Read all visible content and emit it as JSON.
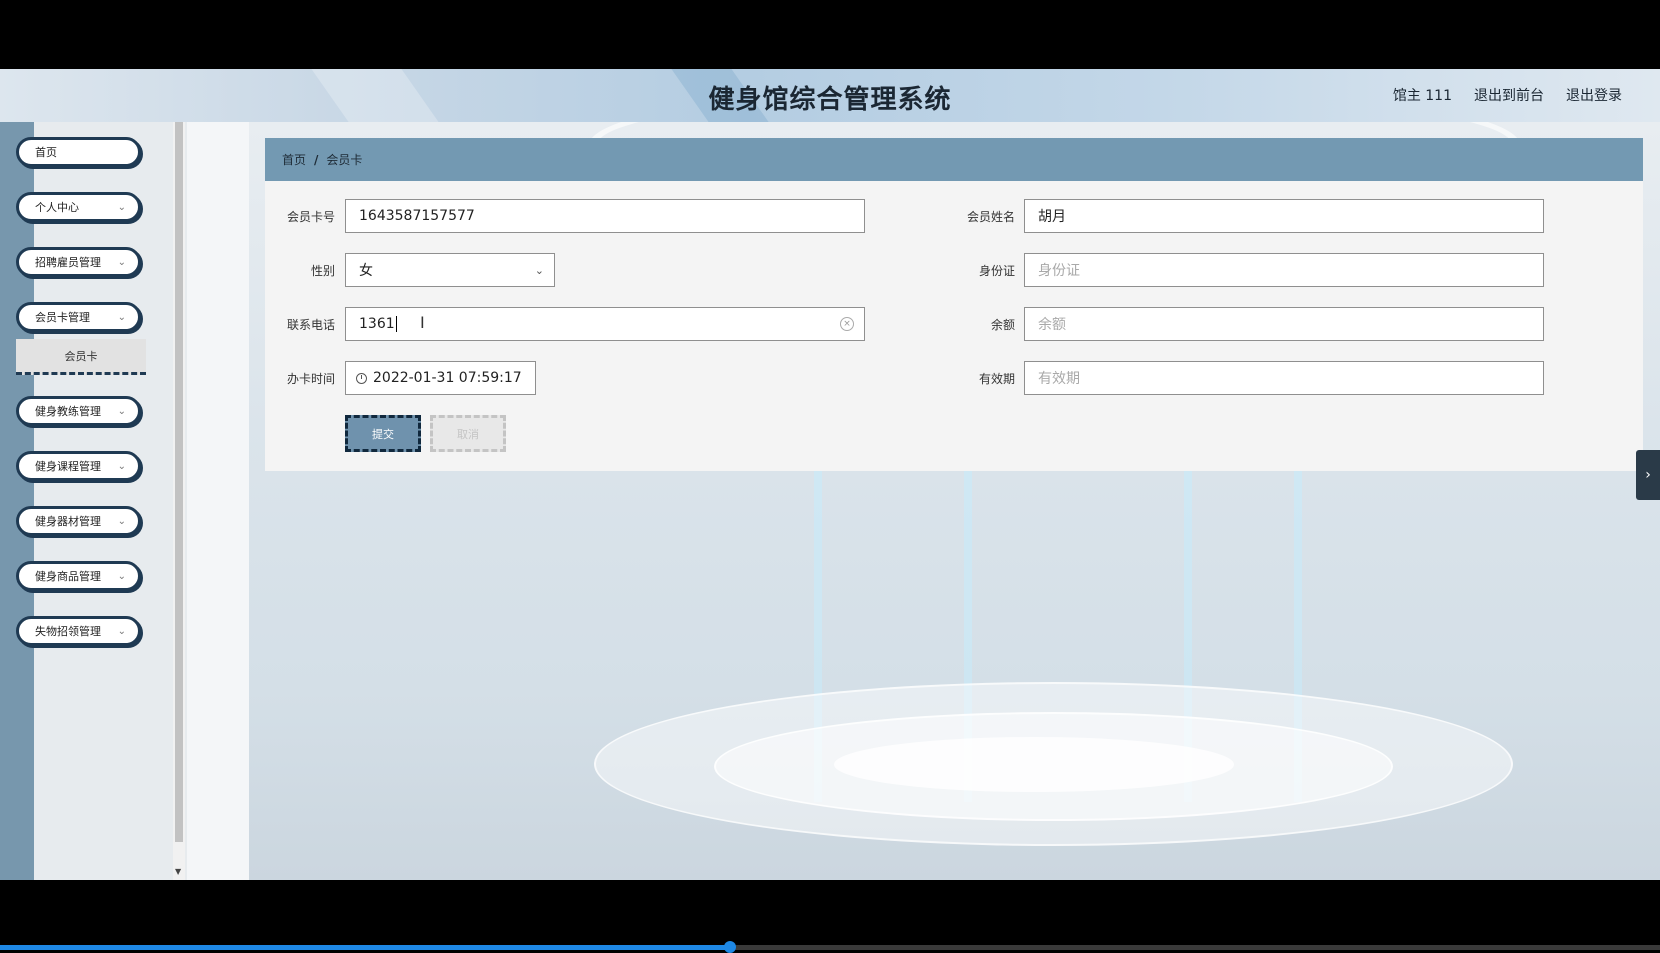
{
  "header": {
    "title": "健身馆综合管理系统",
    "links": [
      "馆主 111",
      "退出到前台",
      "退出登录"
    ]
  },
  "sidebar": {
    "items": [
      {
        "label": "首页",
        "has_chevron": false
      },
      {
        "label": "个人中心",
        "has_chevron": true
      },
      {
        "label": "招聘雇员管理",
        "has_chevron": true
      },
      {
        "label": "会员卡管理",
        "has_chevron": true
      },
      {
        "label": "健身教练管理",
        "has_chevron": true
      },
      {
        "label": "健身课程管理",
        "has_chevron": true
      },
      {
        "label": "健身器材管理",
        "has_chevron": true
      },
      {
        "label": "健身商品管理",
        "has_chevron": true
      },
      {
        "label": "失物招领管理",
        "has_chevron": true
      }
    ],
    "submenu": {
      "label": "会员卡"
    }
  },
  "breadcrumb": {
    "home": "首页",
    "separator": "/",
    "current": "会员卡"
  },
  "form": {
    "card_no": {
      "label": "会员卡号",
      "value": "1643587157577"
    },
    "member_name": {
      "label": "会员姓名",
      "value": "胡月"
    },
    "gender": {
      "label": "性别",
      "value": "女"
    },
    "id_card": {
      "label": "身份证",
      "placeholder": "身份证"
    },
    "phone": {
      "label": "联系电话",
      "value": "1361"
    },
    "balance": {
      "label": "余额",
      "placeholder": "余额"
    },
    "issue_time": {
      "label": "办卡时间",
      "value": "2022-01-31 07:59:17"
    },
    "valid_until": {
      "label": "有效期",
      "placeholder": "有效期"
    },
    "submit_label": "提交",
    "cancel_label": "取消"
  },
  "colors": {
    "accent": "#7399b2",
    "sidebar_rail": "#7797ad",
    "menu_border": "#1f3a53",
    "submit_bg": "#6f92ad"
  },
  "video_progress": 0.44
}
